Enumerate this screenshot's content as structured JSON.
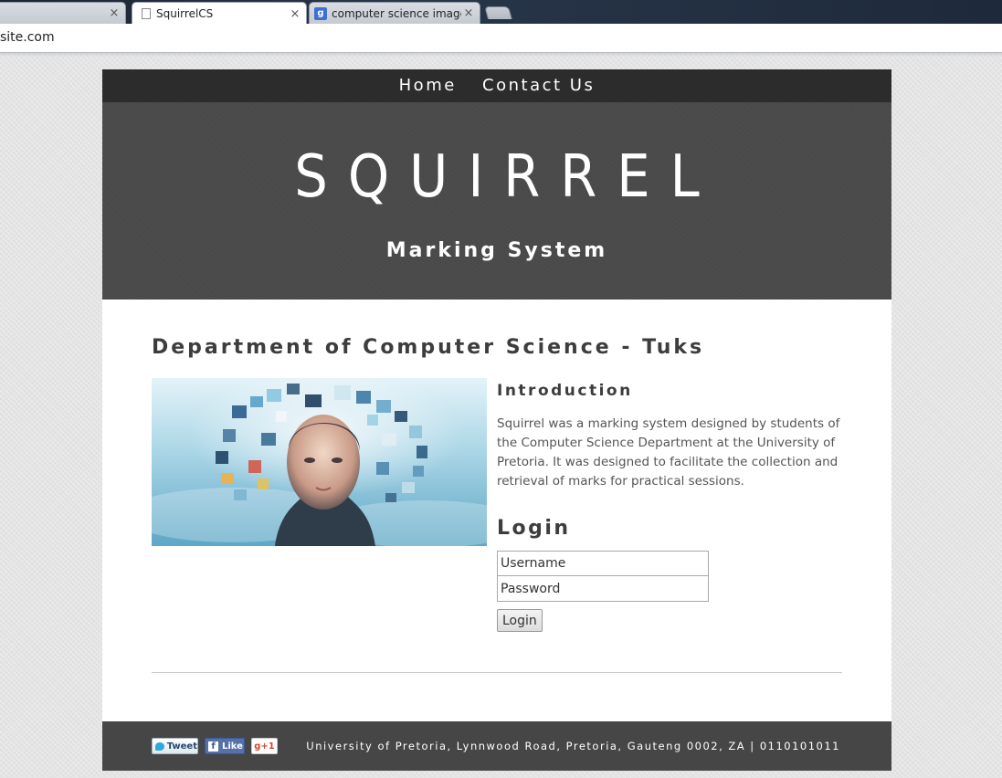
{
  "browser": {
    "tabs": [
      {
        "title": "",
        "active": false
      },
      {
        "title": "SquirrelCS",
        "active": true
      },
      {
        "title": "computer science images",
        "active": false
      }
    ],
    "close_glyph": "×",
    "address": "site.com"
  },
  "nav": {
    "items": [
      {
        "label": "Home"
      },
      {
        "label": "Contact Us"
      }
    ]
  },
  "hero": {
    "title": "SQUIRREL",
    "subtitle": "Marking System"
  },
  "main": {
    "title": "Department of Computer Science - Tuks",
    "intro": {
      "heading": "Introduction",
      "text": "Squirrel was a marking system designed by students of the Computer Science Department at the University of Pretoria. It was designed to facilitate the collection and retrieval of marks for practical sessions."
    },
    "login": {
      "heading": "Login",
      "username_placeholder": "Username",
      "password_placeholder": "Password",
      "button_label": "Login"
    }
  },
  "footer": {
    "social": {
      "tweet_label": "Tweet",
      "like_label": "Like",
      "gplus_label": "g+1"
    },
    "address": "University of Pretoria, Lynnwood Road, Pretoria, Gauteng 0002, ZA | 0110101011"
  },
  "colors": {
    "nav_bg": "#2c2c2c",
    "hero_bg": "#4a4a4a",
    "footer_bg": "#464646",
    "heading_text": "#3d3d3d",
    "body_text": "#555555",
    "page_bg": "#e4e4e4"
  }
}
